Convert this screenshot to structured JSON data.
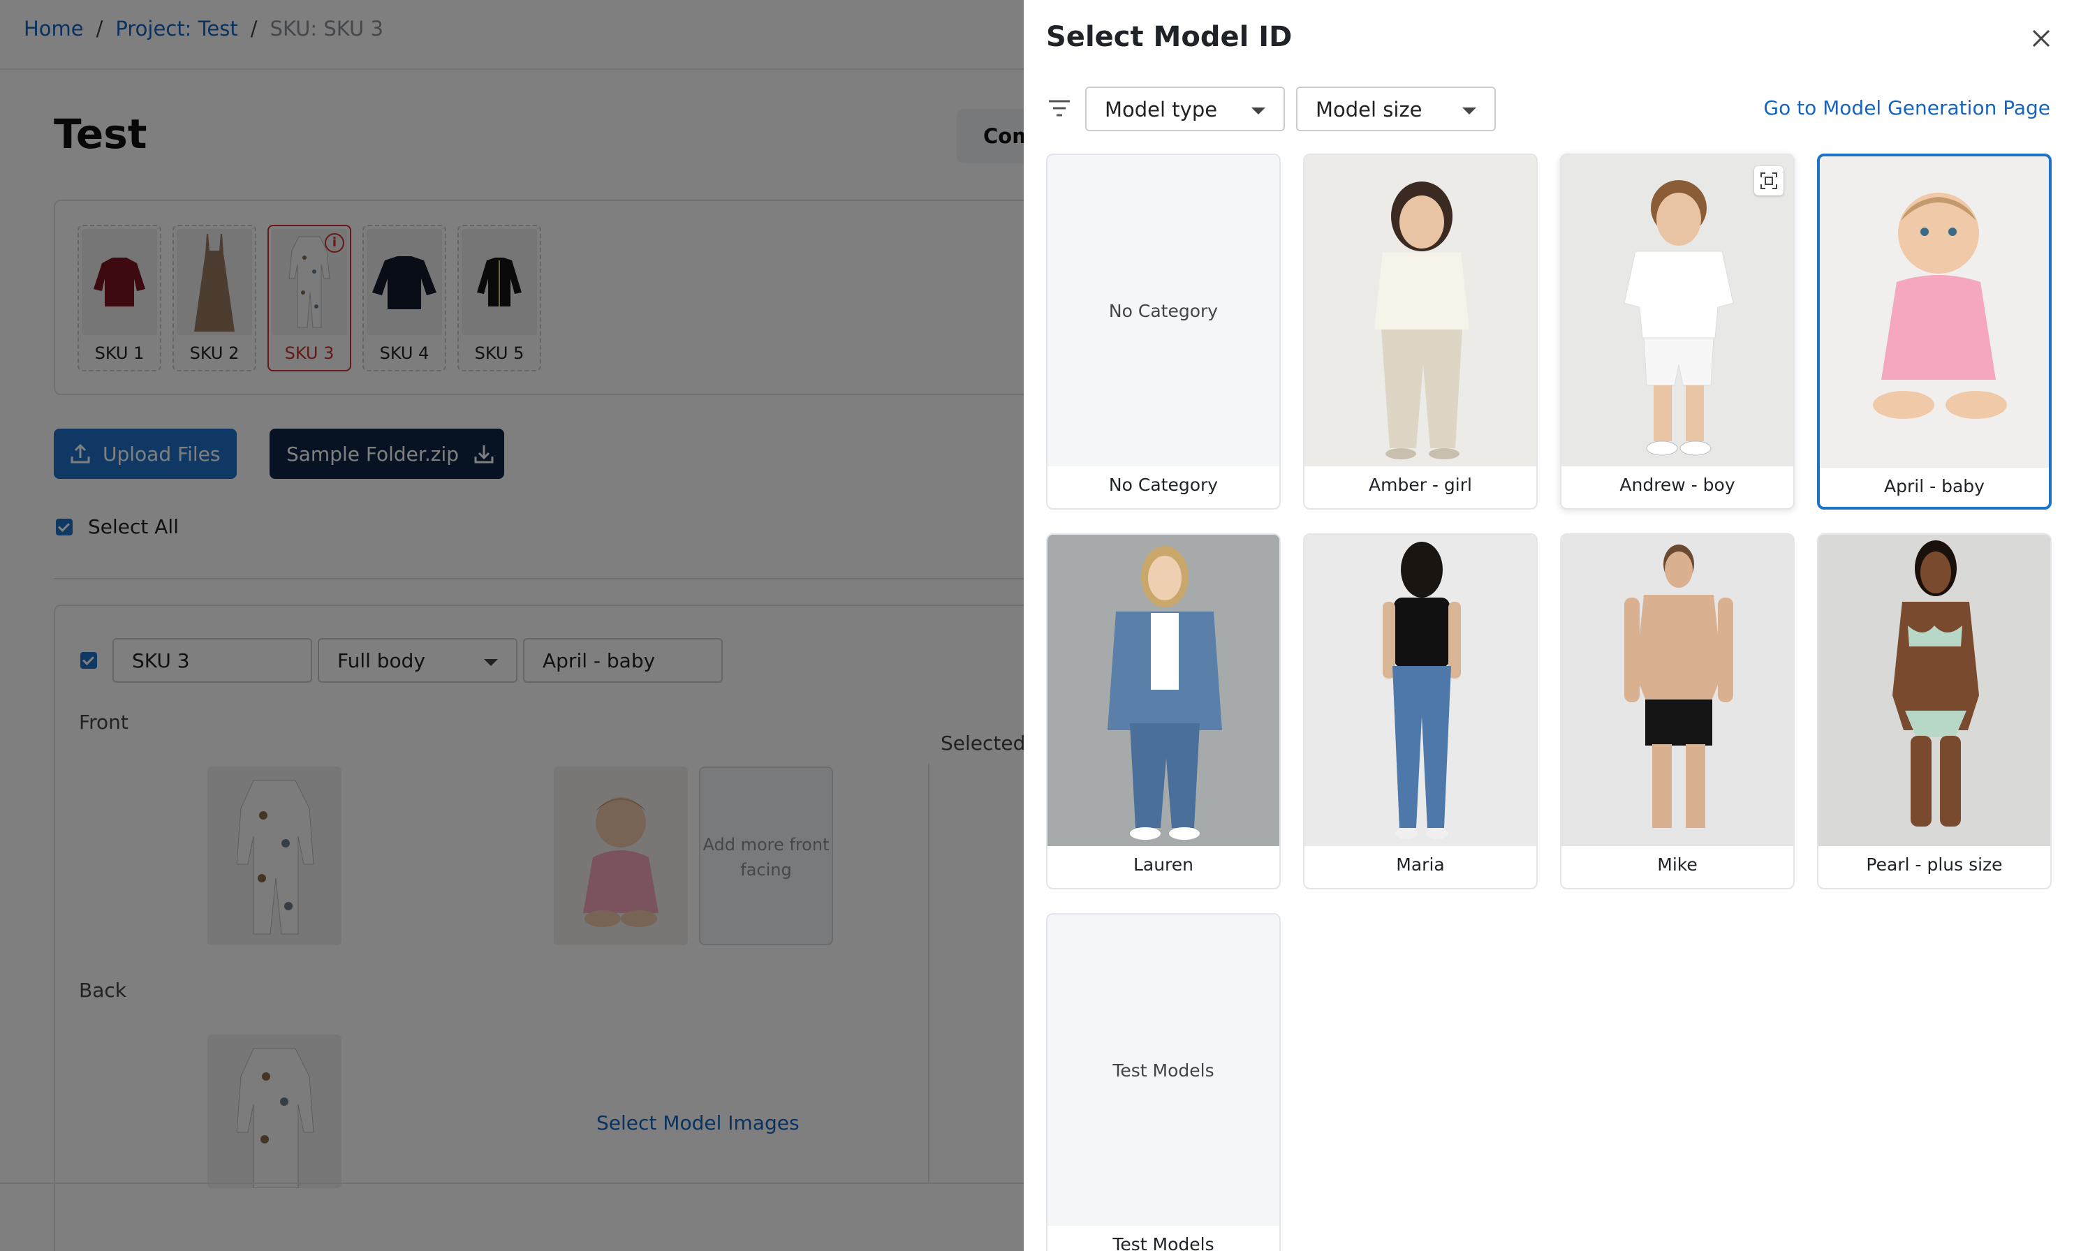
{
  "breadcrumb": {
    "home": "Home",
    "project": "Project: Test",
    "current": "SKU: SKU 3",
    "separator": "/"
  },
  "page": {
    "title": "Test",
    "comp_button": "Com"
  },
  "skus": [
    {
      "label": "SKU 1",
      "garment": "red-sweater"
    },
    {
      "label": "SKU 2",
      "garment": "beige-slip-dress"
    },
    {
      "label": "SKU 3",
      "garment": "baby-sleepsuit",
      "active": true,
      "badge": "i"
    },
    {
      "label": "SKU 4",
      "garment": "navy-sweater"
    },
    {
      "label": "SKU 5",
      "garment": "black-cardigan"
    }
  ],
  "actions": {
    "upload_label": "Upload Files",
    "sample_label": "Sample Folder.zip",
    "select_all_label": "Select All"
  },
  "sku_detail": {
    "sku_name": "SKU 3",
    "shot_type": "Full body",
    "model": "April - baby",
    "front_label": "Front",
    "back_label": "Back",
    "add_more_label": "Add more front facing",
    "select_model_images": "Select Model Images",
    "selected_label": "Selected"
  },
  "drawer": {
    "title": "Select Model ID",
    "filter_model_type": "Model type",
    "filter_model_size": "Model size",
    "go_link": "Go to Model Generation Page",
    "cards": [
      {
        "label": "No Category",
        "placeholder": "No Category",
        "image": "none"
      },
      {
        "label": "Amber - girl",
        "image": "girl-cream-outfit"
      },
      {
        "label": "Andrew - boy",
        "image": "boy-white-outfit",
        "hovered": true
      },
      {
        "label": "April - baby",
        "image": "baby-pink-dress",
        "selected": true
      },
      {
        "label": "Lauren",
        "image": "woman-denim"
      },
      {
        "label": "Maria",
        "image": "woman-back-jeans"
      },
      {
        "label": "Mike",
        "image": "man-boxers"
      },
      {
        "label": "Pearl - plus size",
        "image": "woman-bikini"
      },
      {
        "label": "Test Models",
        "placeholder": "Test Models",
        "image": "none"
      }
    ]
  },
  "colors": {
    "accent": "#1e73c8",
    "link": "#1565c0",
    "danger": "#d32f2f",
    "dark_button": "#0f2747",
    "overlay": "rgba(0,0,0,0.5)"
  }
}
